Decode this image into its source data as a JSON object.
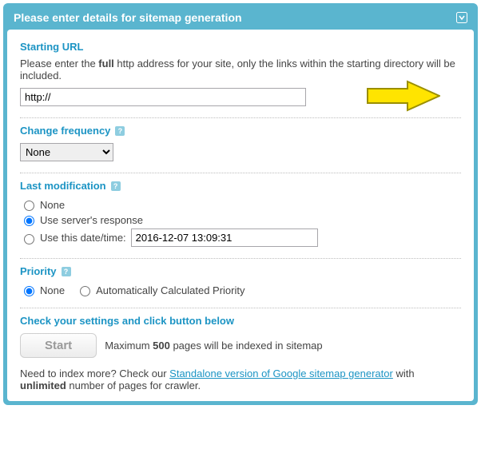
{
  "panel": {
    "title": "Please enter details for sitemap generation"
  },
  "startingUrl": {
    "title": "Starting URL",
    "desc_pre": "Please enter the ",
    "desc_bold": "full",
    "desc_post": " http address for your site, only the links within the starting directory will be included.",
    "value": "http://"
  },
  "changeFreq": {
    "title": "Change frequency",
    "selected": "None"
  },
  "lastMod": {
    "title": "Last modification",
    "opt_none": "None",
    "opt_server": "Use server's response",
    "opt_datetime": "Use this date/time:",
    "dt_value": "2016-12-07 13:09:31"
  },
  "priority": {
    "title": "Priority",
    "opt_none": "None",
    "opt_auto": "Automatically Calculated Priority"
  },
  "submit": {
    "heading": "Check your settings and click button below",
    "button": "Start",
    "max_pre": "Maximum ",
    "max_num": "500",
    "max_post": " pages will be indexed in sitemap",
    "more_pre": "Need to index more? Check our ",
    "more_link": "Standalone version of Google sitemap generator",
    "more_mid": " with ",
    "more_bold": "unlimited",
    "more_post": " number of pages for crawler."
  }
}
